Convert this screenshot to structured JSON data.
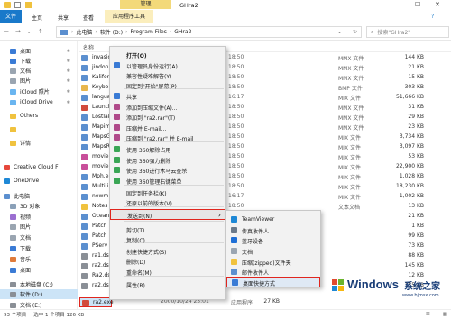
{
  "titlebar": {
    "manage_tab": "管理",
    "title": "GHra2"
  },
  "ribbon": {
    "file": "文件",
    "home": "主页",
    "share": "共享",
    "view": "查看",
    "app_tools": "应用程序工具"
  },
  "breadcrumb": {
    "parts": [
      "此电脑",
      "软件 (D:)",
      "Program Files",
      "GHra2"
    ],
    "search_placeholder": "搜索\"GHra2\""
  },
  "columns": {
    "name": "名称"
  },
  "sidebar": [
    {
      "label": "桌面",
      "pin": "✱"
    },
    {
      "label": "下载",
      "pin": "✱"
    },
    {
      "label": "文档",
      "pin": "✱"
    },
    {
      "label": "图片",
      "pin": "✱"
    },
    {
      "label": "iCloud 照片",
      "pin": "✱"
    },
    {
      "label": "iCloud Drive",
      "pin": "✱"
    },
    {
      "label": "Others",
      "pin": ""
    },
    {
      "label": "",
      "pin": ""
    },
    {
      "label": "详情",
      "pin": ""
    },
    {
      "label": "Creative Cloud F",
      "pin": ""
    },
    {
      "label": "OneDrive",
      "pin": ""
    },
    {
      "label": "此电脑",
      "pin": ""
    },
    {
      "label": "3D 对象",
      "pin": ""
    },
    {
      "label": "视频",
      "pin": ""
    },
    {
      "label": "图片",
      "pin": ""
    },
    {
      "label": "文档",
      "pin": ""
    },
    {
      "label": "下载",
      "pin": ""
    },
    {
      "label": "音乐",
      "pin": ""
    },
    {
      "label": "桌面",
      "pin": ""
    },
    {
      "label": "本地磁盘 (C:)",
      "pin": ""
    },
    {
      "label": "软件 (D:)",
      "pin": ""
    },
    {
      "label": "文档 (E:)",
      "pin": ""
    }
  ],
  "files": [
    {
      "name": "invasio",
      "date": "18:50",
      "type": "MMX 文件",
      "size": "144 KB"
    },
    {
      "name": "jindon",
      "date": "18:50",
      "type": "MMX 文件",
      "size": "21 KB"
    },
    {
      "name": "Kalifor",
      "date": "18:50",
      "type": "MMX 文件",
      "size": "15 KB"
    },
    {
      "name": "Keybo",
      "date": "18:50",
      "type": "BMP 文件",
      "size": "303 KB"
    },
    {
      "name": "langua",
      "date": "16:17",
      "type": "MIX 文件",
      "size": "51,666 KB"
    },
    {
      "name": "Launch",
      "date": "18:50",
      "type": "MMX 文件",
      "size": "31 KB"
    },
    {
      "name": "Lostlak",
      "date": "18:50",
      "type": "MMX 文件",
      "size": "29 KB"
    },
    {
      "name": "Mapim",
      "date": "18:50",
      "type": "MMX 文件",
      "size": "23 KB"
    },
    {
      "name": "MapsG",
      "date": "18:50",
      "type": "MIX 文件",
      "size": "3,734 KB"
    },
    {
      "name": "MapsR",
      "date": "18:50",
      "type": "MIX 文件",
      "size": "3,097 KB"
    },
    {
      "name": "movie",
      "date": "18:50",
      "type": "MIX 文件",
      "size": "53 KB"
    },
    {
      "name": "movie",
      "date": "18:50",
      "type": "MIX 文件",
      "size": "22,900 KB"
    },
    {
      "name": "Mph.e",
      "date": "18:50",
      "type": "MIX 文件",
      "size": "1,028 KB"
    },
    {
      "name": "Multi.i",
      "date": "18:50",
      "type": "MIX 文件",
      "size": "18,230 KB"
    },
    {
      "name": "newm",
      "date": "16:17",
      "type": "MIX 文件",
      "size": "1,002 KB"
    },
    {
      "name": "Notes",
      "date": "18:50",
      "type": "文本文档",
      "size": "13 KB"
    },
    {
      "name": "Ocean",
      "date": "",
      "type": "",
      "size": "21 KB"
    },
    {
      "name": "Patch",
      "date": "",
      "type": "",
      "size": "1 KB"
    },
    {
      "name": "Patch",
      "date": "",
      "type": "",
      "size": "99 KB"
    },
    {
      "name": "PServ",
      "date": "",
      "type": "",
      "size": "73 KB"
    },
    {
      "name": "ra1.ds",
      "date": "",
      "type": "",
      "size": "88 KB"
    },
    {
      "name": "ra2.ds",
      "date": "",
      "type": "",
      "size": "145 KB"
    },
    {
      "name": "Ra2.ds",
      "date": "",
      "type": "",
      "size": "12 KB"
    },
    {
      "name": "ra2.ds",
      "date": "",
      "type": "",
      "size": "155 KB"
    },
    {
      "name": "ra2.exe",
      "date": "2000/10/24 23:01",
      "type": "应用程序",
      "size": "27 KB"
    }
  ],
  "context_menu": {
    "items": [
      "打开(O)",
      "以管理员身份运行(A)",
      "兼容性疑难解答(Y)",
      "固定到\"开始\"屏幕(P)",
      "共享",
      "添加到压缩文件(A)...",
      "添加到 \"ra2.rar\"(T)",
      "压缩并 E-mail...",
      "压缩到 \"ra2.rar\" 并 E-mail",
      "使用 360解除占用",
      "使用 360强力删除",
      "使用 360进行木马云查杀",
      "使用 360管理右键菜单",
      "固定到任务栏(K)",
      "还原以前的版本(V)",
      "发送到(N)",
      "剪切(T)",
      "复制(C)",
      "创建快捷方式(S)",
      "删除(D)",
      "重命名(M)",
      "属性(R)"
    ],
    "sendto_arrow": "›"
  },
  "submenu": {
    "items": [
      "TeamViewer",
      "传真收件人",
      "蓝牙设备",
      "文档",
      "压缩(zipped)文件夹",
      "邮件收件人",
      "桌面快捷方式"
    ]
  },
  "status": {
    "count": "93 个项目",
    "selected": "选中 1 个项目  126 KB"
  },
  "watermark": {
    "brand": "Windows",
    "cn": "系统之家",
    "url": "www.bjmsx.com"
  },
  "colors": {
    "accent": "#1979ca",
    "highlight": "#e0261e",
    "manage": "#f3d97a"
  }
}
